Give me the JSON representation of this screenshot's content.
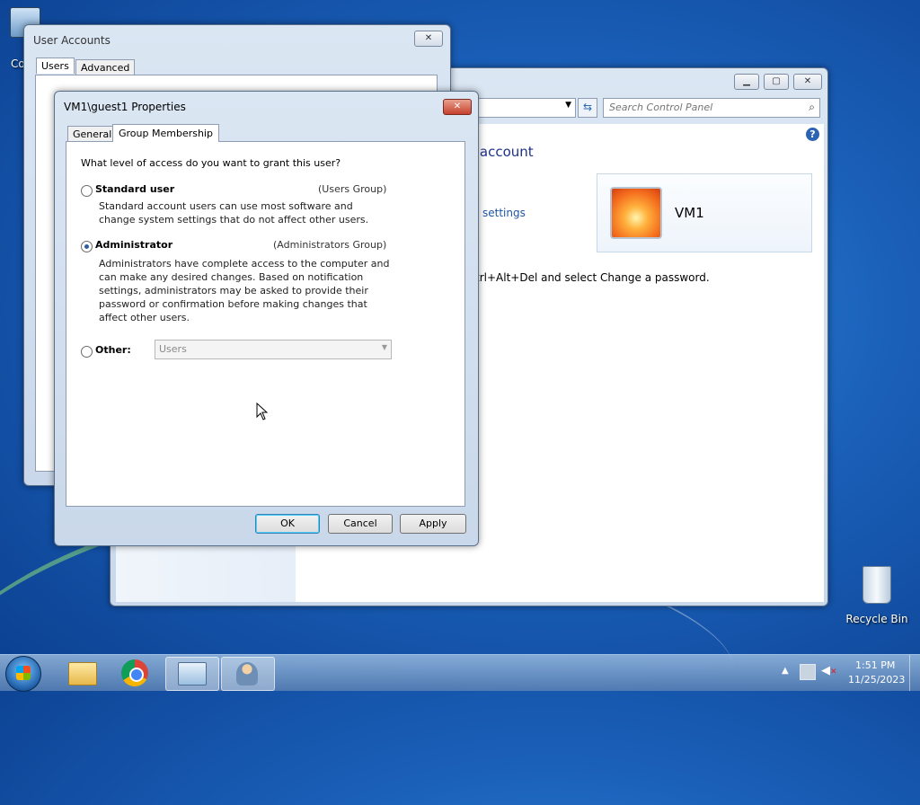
{
  "desktop": {
    "icons": [
      {
        "label": "Co"
      },
      {
        "label": "Recycle Bin"
      }
    ]
  },
  "user_accounts_window": {
    "title": "User Accounts",
    "close_label": "✕",
    "tabs": [
      "Users",
      "Advanced"
    ]
  },
  "control_panel": {
    "search_placeholder": "Search Control Panel",
    "heading_fragment": "r account",
    "link_fragment": "settings",
    "account_name": "VM1",
    "password_hint_fragment": "trl+Alt+Del and select Change a password.",
    "help_label": "?"
  },
  "properties_dialog": {
    "title": "VM1\\guest1 Properties",
    "close_label": "✕",
    "tabs": [
      "General",
      "Group Membership"
    ],
    "question": "What level of access do you want to grant this user?",
    "standard_user": {
      "label": "Standard user",
      "group": "(Users Group)",
      "description": "Standard account users can use most software and change system settings that do not affect other users.",
      "checked": false
    },
    "administrator": {
      "label": "Administrator",
      "group": "(Administrators Group)",
      "description": "Administrators have complete access to the computer and can make any desired changes. Based on notification settings, administrators may be asked to provide their password or confirmation before making changes that affect other users.",
      "checked": true
    },
    "other": {
      "label": "Other:",
      "selected_value": "Users",
      "checked": false
    },
    "buttons": {
      "ok": "OK",
      "cancel": "Cancel",
      "apply": "Apply"
    }
  },
  "taskbar": {
    "items": [
      "start-orb",
      "windows-explorer",
      "google-chrome",
      "control-panel",
      "user-accounts"
    ],
    "time": "1:51 PM",
    "date": "11/25/2023"
  }
}
